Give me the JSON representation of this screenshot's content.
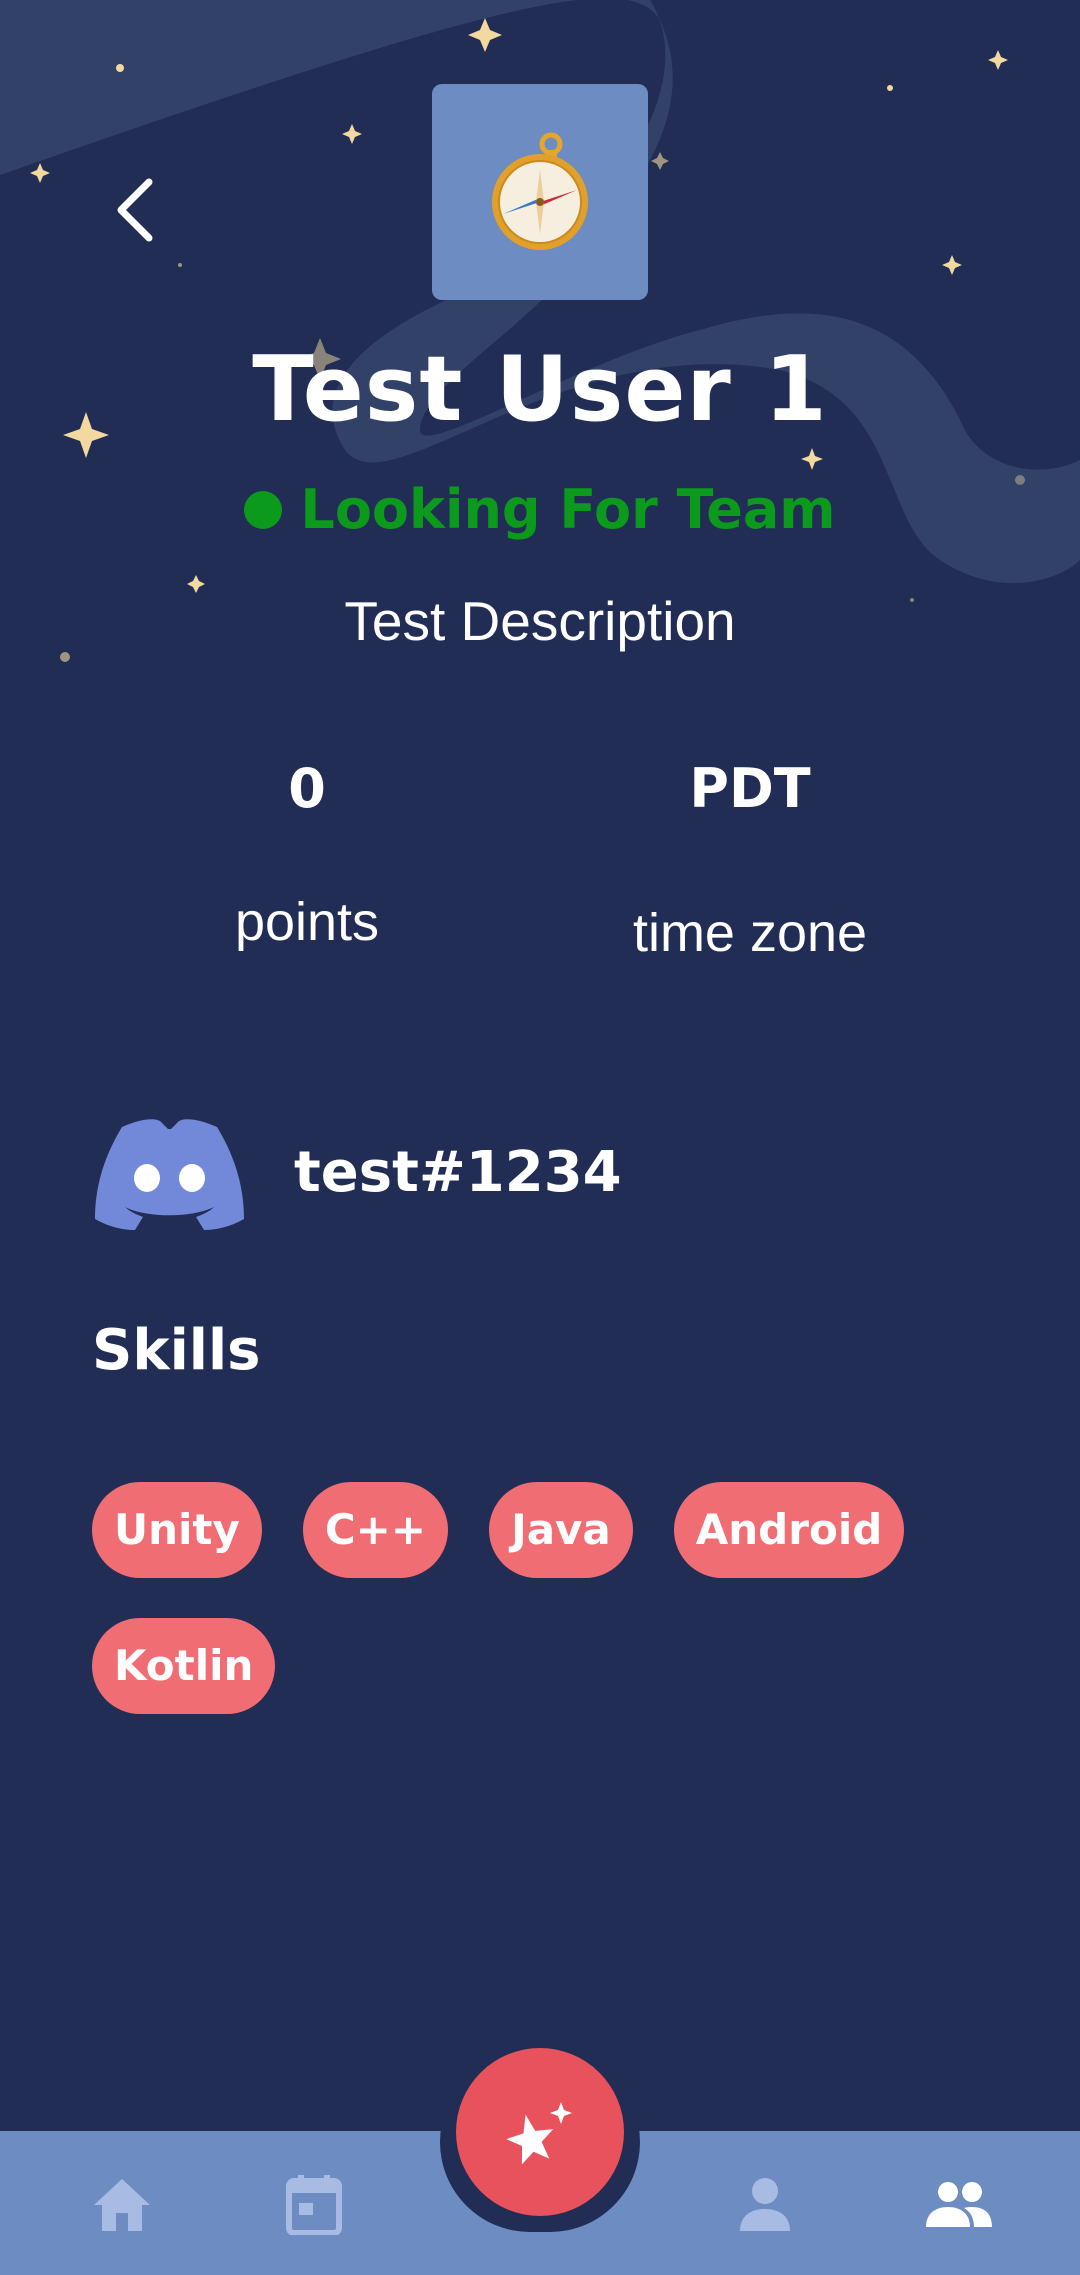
{
  "profile": {
    "name": "Test User 1",
    "status": "Looking For Team",
    "description": "Test Description",
    "avatar_icon": "compass-icon"
  },
  "stats": {
    "points_value": "0",
    "points_label": "points",
    "timezone_value": "PDT",
    "timezone_label": "time zone"
  },
  "discord": {
    "icon": "discord-icon",
    "username": "test#1234"
  },
  "skills": {
    "title": "Skills",
    "items": [
      "Unity",
      "C++",
      "Java",
      "Android",
      "Kotlin"
    ]
  },
  "nav": {
    "items": [
      "home-icon",
      "calendar-icon",
      "sparkle-star-icon",
      "person-icon",
      "group-icon"
    ],
    "active": "group-icon"
  },
  "colors": {
    "background": "#212d54",
    "accent": "#6d8cc2",
    "status_green": "#0b9a1b",
    "chip": "#f06d73",
    "fab": "#e8525d"
  }
}
